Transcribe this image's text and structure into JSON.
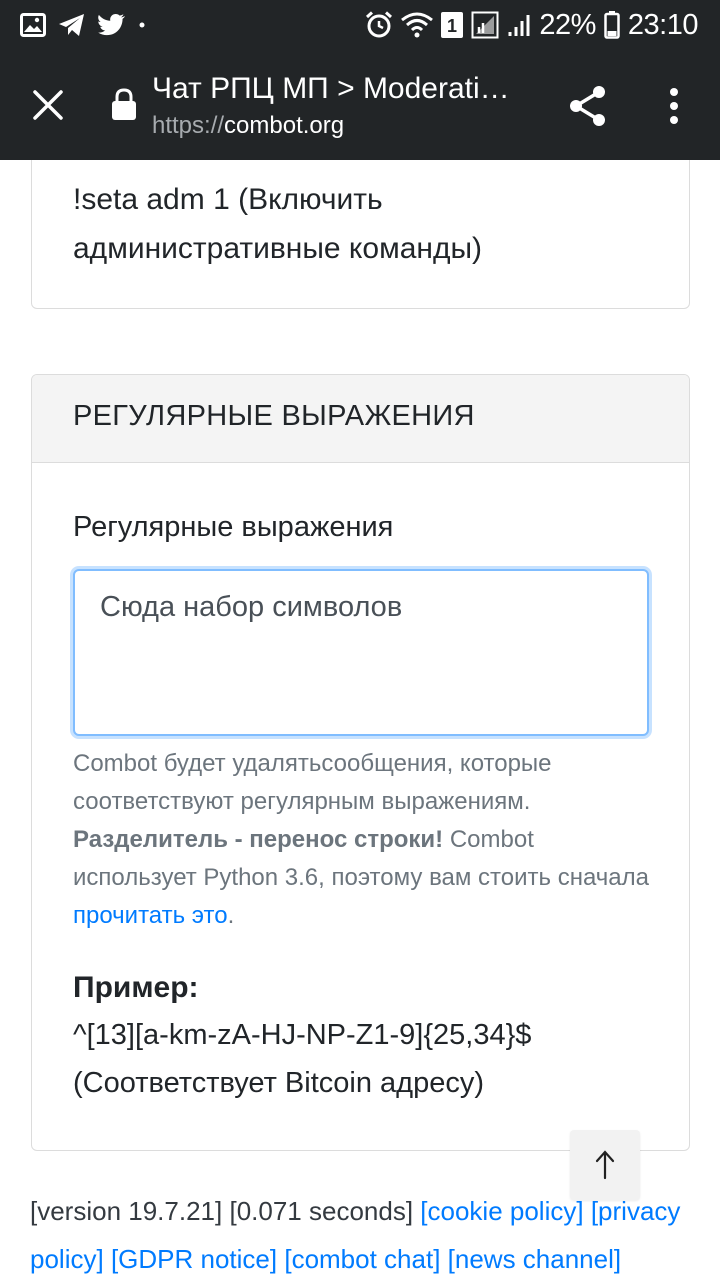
{
  "status_bar": {
    "battery_percent": "22%",
    "time": "23:10",
    "sim_badge": "1",
    "icons_left": [
      "gallery-icon",
      "telegram-icon",
      "twitter-icon",
      "dot-icon"
    ],
    "icons_right": [
      "alarm-icon",
      "wifi-icon",
      "sim-icon",
      "signal-icon",
      "signal-icon",
      "battery-icon"
    ]
  },
  "app_bar": {
    "title": "Чат РПЦ МП > Moderati…",
    "url_scheme": "https://",
    "url_host": "combot.org",
    "colors": {
      "background": "#222527"
    }
  },
  "card1": {
    "text_line1": "!seta adm 1 (Включить",
    "text_line2": "административные команды)"
  },
  "regex_section": {
    "header": "РЕГУЛЯРНЫЕ ВЫРАЖЕНИЯ",
    "field_label": "Регулярные выражения",
    "input_value": "Сюда набор символов",
    "help_text_1": "Combot будет удалятьсообщения, которые соответствуют регулярным выражениям.",
    "help_bold": "Разделитель - перенос строки!",
    "help_text_2": "Combot использует Python 3.6, поэтому вам стоить сначала",
    "help_link": "прочитать это",
    "help_end": ".",
    "example_label": "Пример:",
    "example_pattern": "^[13][a-km-zA-HJ-NP-Z1-9]{25,34}$",
    "example_desc": "(Соответствует Bitcoin адресу)"
  },
  "scroll_top": {
    "glyph": "↑"
  },
  "footer": {
    "version": "[version 19.7.21]",
    "timing": "[0.071 seconds]",
    "links": [
      "[cookie policy]",
      "[privacy policy]",
      "[GDPR notice]",
      "[combot chat]",
      "[news channel]"
    ],
    "colors": {
      "link": "#007bff"
    }
  }
}
